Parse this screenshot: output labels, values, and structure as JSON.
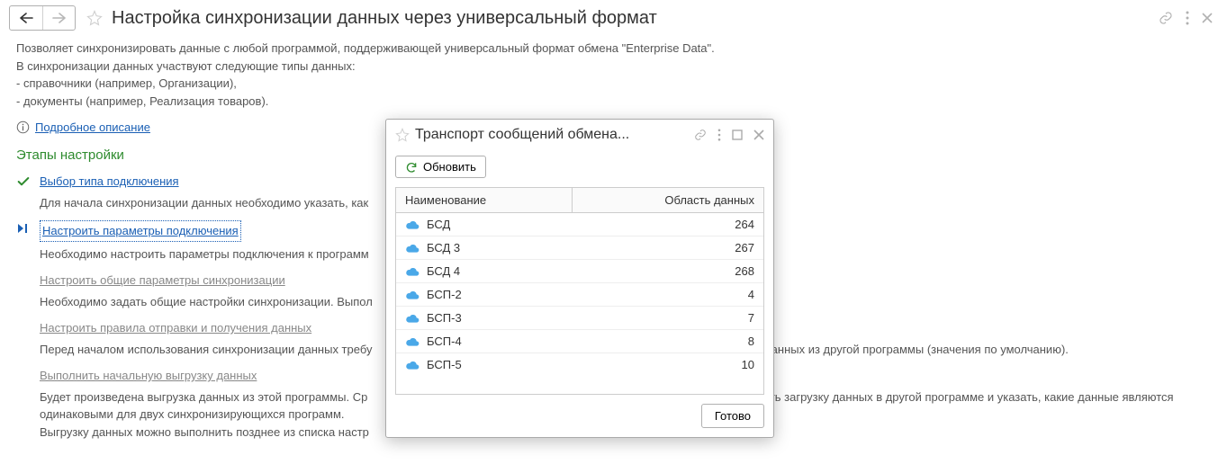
{
  "header": {
    "title": "Настройка синхронизации данных через универсальный формат"
  },
  "desc": {
    "line1": "Позволяет синхронизировать данные с любой программой, поддерживающей универсальный формат обмена \"Enterprise Data\".",
    "line2": "В синхронизации данных участвуют следующие типы данных:",
    "bullet1": " - справочники (например, Организации),",
    "bullet2": " - документы (например, Реализация товаров).",
    "more_link": "Подробное описание"
  },
  "section_title": "Этапы настройки",
  "steps": {
    "s1": {
      "title": "Выбор типа подключения",
      "desc": "Для начала синхронизации данных необходимо указать, как"
    },
    "s2": {
      "title": "Настроить параметры подключения",
      "desc": "Необходимо настроить параметры подключения к программ"
    },
    "s3": {
      "title": "Настроить общие параметры синхронизации",
      "desc": "Необходимо задать общие настройки синхронизации. Выпол"
    },
    "s4": {
      "title": "Настроить правила отправки и получения данных",
      "desc_tail": " данных из другой программы (значения по умолчанию).",
      "desc": "Перед началом использования синхронизации данных требу"
    },
    "s5": {
      "title": "Выполнить начальную выгрузку данных",
      "desc1": "Будет произведена выгрузка данных из этой программы. Ср",
      "desc1_tail": "нить загрузку данных в другой программе и указать, какие данные являются",
      "desc2": "одинаковыми для двух синхронизирующихся программ.",
      "desc3": "Выгрузку данных можно выполнить позднее из списка настр"
    }
  },
  "dialog": {
    "title": "Транспорт сообщений обмена...",
    "refresh": "Обновить",
    "col_name": "Наименование",
    "col_area": "Область данных",
    "rows": [
      {
        "name": "БСД",
        "area": "264"
      },
      {
        "name": "БСД 3",
        "area": "267"
      },
      {
        "name": "БСД 4",
        "area": "268"
      },
      {
        "name": "БСП-2",
        "area": "4"
      },
      {
        "name": "БСП-3",
        "area": "7"
      },
      {
        "name": "БСП-4",
        "area": "8"
      },
      {
        "name": "БСП-5",
        "area": "10"
      }
    ],
    "done": "Готово"
  }
}
